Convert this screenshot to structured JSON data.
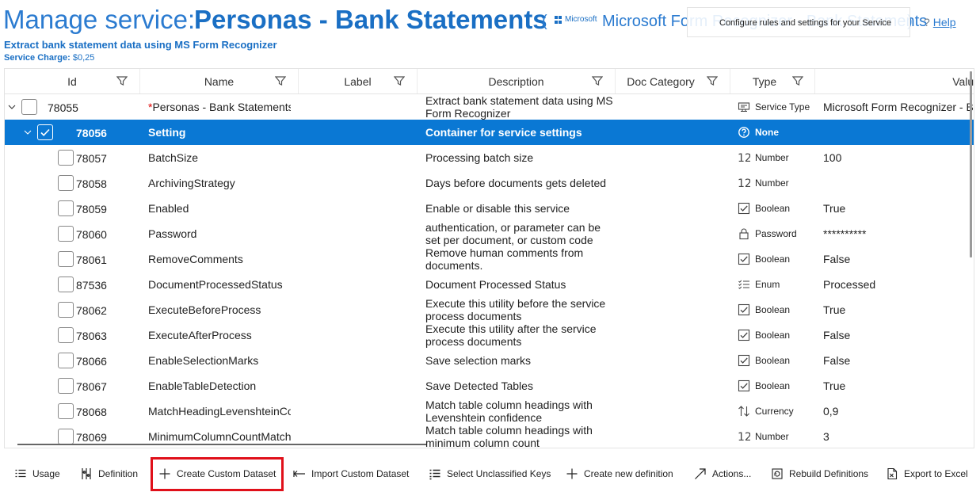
{
  "header": {
    "title_prefix": "Manage service:",
    "title_name": "Personas - Bank Statements",
    "paren_open": "(",
    "paren_close": ")",
    "ms_logo_text": "Microsoft",
    "service_type_text": "Microsoft Form Recognizer - Bank Statements",
    "tooltip": "Configure rules and settings for your Service",
    "help_q": "?",
    "help_label": "Help",
    "subtitle": "Extract bank statement data using MS Form Recognizer",
    "service_charge_label": "Service Charge:",
    "service_charge_value": "$0,25"
  },
  "columns": [
    "Id",
    "Name",
    "Label",
    "Description",
    "Doc Category",
    "Type",
    "Value"
  ],
  "rows": [
    {
      "id": "78055",
      "name": "Personas - Bank Statements",
      "required": "*",
      "label": "",
      "description": "Extract bank statement data using MS Form Recognizer",
      "type": "Service Type",
      "type_icon": "monitor-icon",
      "value": "Microsoft Form Recognizer - Ba",
      "level": 0,
      "expanded": true,
      "checked": false,
      "selected": false
    },
    {
      "id": "78056",
      "name": "Setting",
      "label": "",
      "description": "Container for service settings",
      "type": "None",
      "type_icon": "question-circle-icon",
      "value": "",
      "level": 1,
      "expanded": true,
      "checked": true,
      "selected": true
    },
    {
      "id": "78057",
      "name": "BatchSize",
      "label": "",
      "description": "Processing batch size",
      "type": "Number",
      "type_icon": "number-icon",
      "value": "100",
      "level": 2,
      "checked": false,
      "selected": false
    },
    {
      "id": "78058",
      "name": "ArchivingStrategy",
      "label": "",
      "description": "Days before documents gets deleted",
      "type": "Number",
      "type_icon": "number-icon",
      "value": "",
      "level": 2,
      "checked": false,
      "selected": false
    },
    {
      "id": "78059",
      "name": "Enabled",
      "label": "",
      "description": "Enable or disable this service",
      "type": "Boolean",
      "type_icon": "checkbox-icon",
      "value": "True",
      "level": 2,
      "checked": false,
      "selected": false
    },
    {
      "id": "78060",
      "name": "Password",
      "label": "",
      "description": "authentication, or parameter can be set per document, or custom code",
      "type": "Password",
      "type_icon": "lock-icon",
      "value": "**********",
      "level": 2,
      "checked": false,
      "selected": false
    },
    {
      "id": "78061",
      "name": "RemoveComments",
      "label": "",
      "description": "Remove human comments from documents.",
      "type": "Boolean",
      "type_icon": "checkbox-icon",
      "value": "False",
      "level": 2,
      "checked": false,
      "selected": false
    },
    {
      "id": "87536",
      "name": "DocumentProcessedStatus",
      "label": "",
      "description": "Document Processed Status",
      "type": "Enum",
      "type_icon": "list-icon",
      "value": "Processed",
      "level": 2,
      "checked": false,
      "selected": false
    },
    {
      "id": "78062",
      "name": "ExecuteBeforeProcess",
      "label": "",
      "description": "Execute this utility before the service process documents",
      "type": "Boolean",
      "type_icon": "checkbox-icon",
      "value": "True",
      "level": 2,
      "checked": false,
      "selected": false
    },
    {
      "id": "78063",
      "name": "ExecuteAfterProcess",
      "label": "",
      "description": "Execute this utility after the service process documents",
      "type": "Boolean",
      "type_icon": "checkbox-icon",
      "value": "False",
      "level": 2,
      "checked": false,
      "selected": false
    },
    {
      "id": "78066",
      "name": "EnableSelectionMarks",
      "label": "",
      "description": "Save selection marks",
      "type": "Boolean",
      "type_icon": "checkbox-icon",
      "value": "False",
      "level": 2,
      "checked": false,
      "selected": false
    },
    {
      "id": "78067",
      "name": "EnableTableDetection",
      "label": "",
      "description": "Save Detected Tables",
      "type": "Boolean",
      "type_icon": "checkbox-icon",
      "value": "True",
      "level": 2,
      "checked": false,
      "selected": false
    },
    {
      "id": "78068",
      "name": "MatchHeadingLevenshteinCo",
      "label": "",
      "description": "Match table column headings with Levenshtein confidence",
      "type": "Currency",
      "type_icon": "sort-arrows-icon",
      "value": "0,9",
      "level": 2,
      "checked": false,
      "selected": false
    },
    {
      "id": "78069",
      "name": "MinimumColumnCountMatch",
      "label": "",
      "description": "Match table column headings with minimum column count",
      "type": "Number",
      "type_icon": "number-icon",
      "value": "3",
      "level": 2,
      "checked": false,
      "selected": false
    }
  ],
  "toolbar": [
    {
      "label": "Usage",
      "icon": "usage-icon"
    },
    {
      "label": "Definition",
      "icon": "definition-icon"
    },
    {
      "label": "Create Custom Dataset",
      "icon": "plus-icon",
      "highlighted": true
    },
    {
      "label": "Import Custom Dataset",
      "icon": "import-arrow-icon"
    },
    {
      "label": "Select Unclassified Keys",
      "icon": "checklist-icon"
    },
    {
      "label": "Create new definition",
      "icon": "plus-icon"
    },
    {
      "label": "Actions...",
      "icon": "actions-arrow-icon"
    },
    {
      "label": "Rebuild Definitions",
      "icon": "rebuild-icon"
    },
    {
      "label": "Export to Excel",
      "icon": "excel-icon"
    }
  ],
  "colors": {
    "accent": "#0a78d4",
    "title": "#1a6fc4",
    "highlight_box": "#e0101a"
  }
}
